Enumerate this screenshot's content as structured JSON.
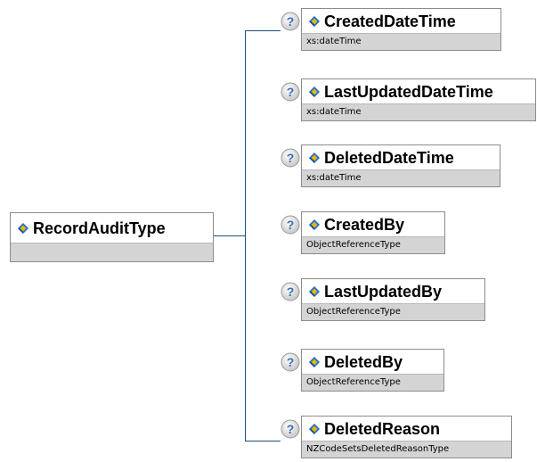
{
  "root": {
    "name": "RecordAuditType",
    "type": ""
  },
  "children": [
    {
      "name": "CreatedDateTime",
      "type": "xs:dateTime"
    },
    {
      "name": "LastUpdatedDateTime",
      "type": "xs:dateTime"
    },
    {
      "name": "DeletedDateTime",
      "type": "xs:dateTime"
    },
    {
      "name": "CreatedBy",
      "type": "ObjectReferenceType"
    },
    {
      "name": "LastUpdatedBy",
      "type": "ObjectReferenceType"
    },
    {
      "name": "DeletedBy",
      "type": "ObjectReferenceType"
    },
    {
      "name": "DeletedReason",
      "type": "NZCodeSetsDeletedReasonType"
    }
  ],
  "colors": {
    "connector": "#1f4e79",
    "type_band": "#d4d4d4",
    "border": "#8c8c8c",
    "icon_blue": "#1e6fd0",
    "icon_gold": "#f0b400"
  },
  "icons": {
    "element": "element-diamond-icon",
    "optional": "question-mark-icon"
  }
}
